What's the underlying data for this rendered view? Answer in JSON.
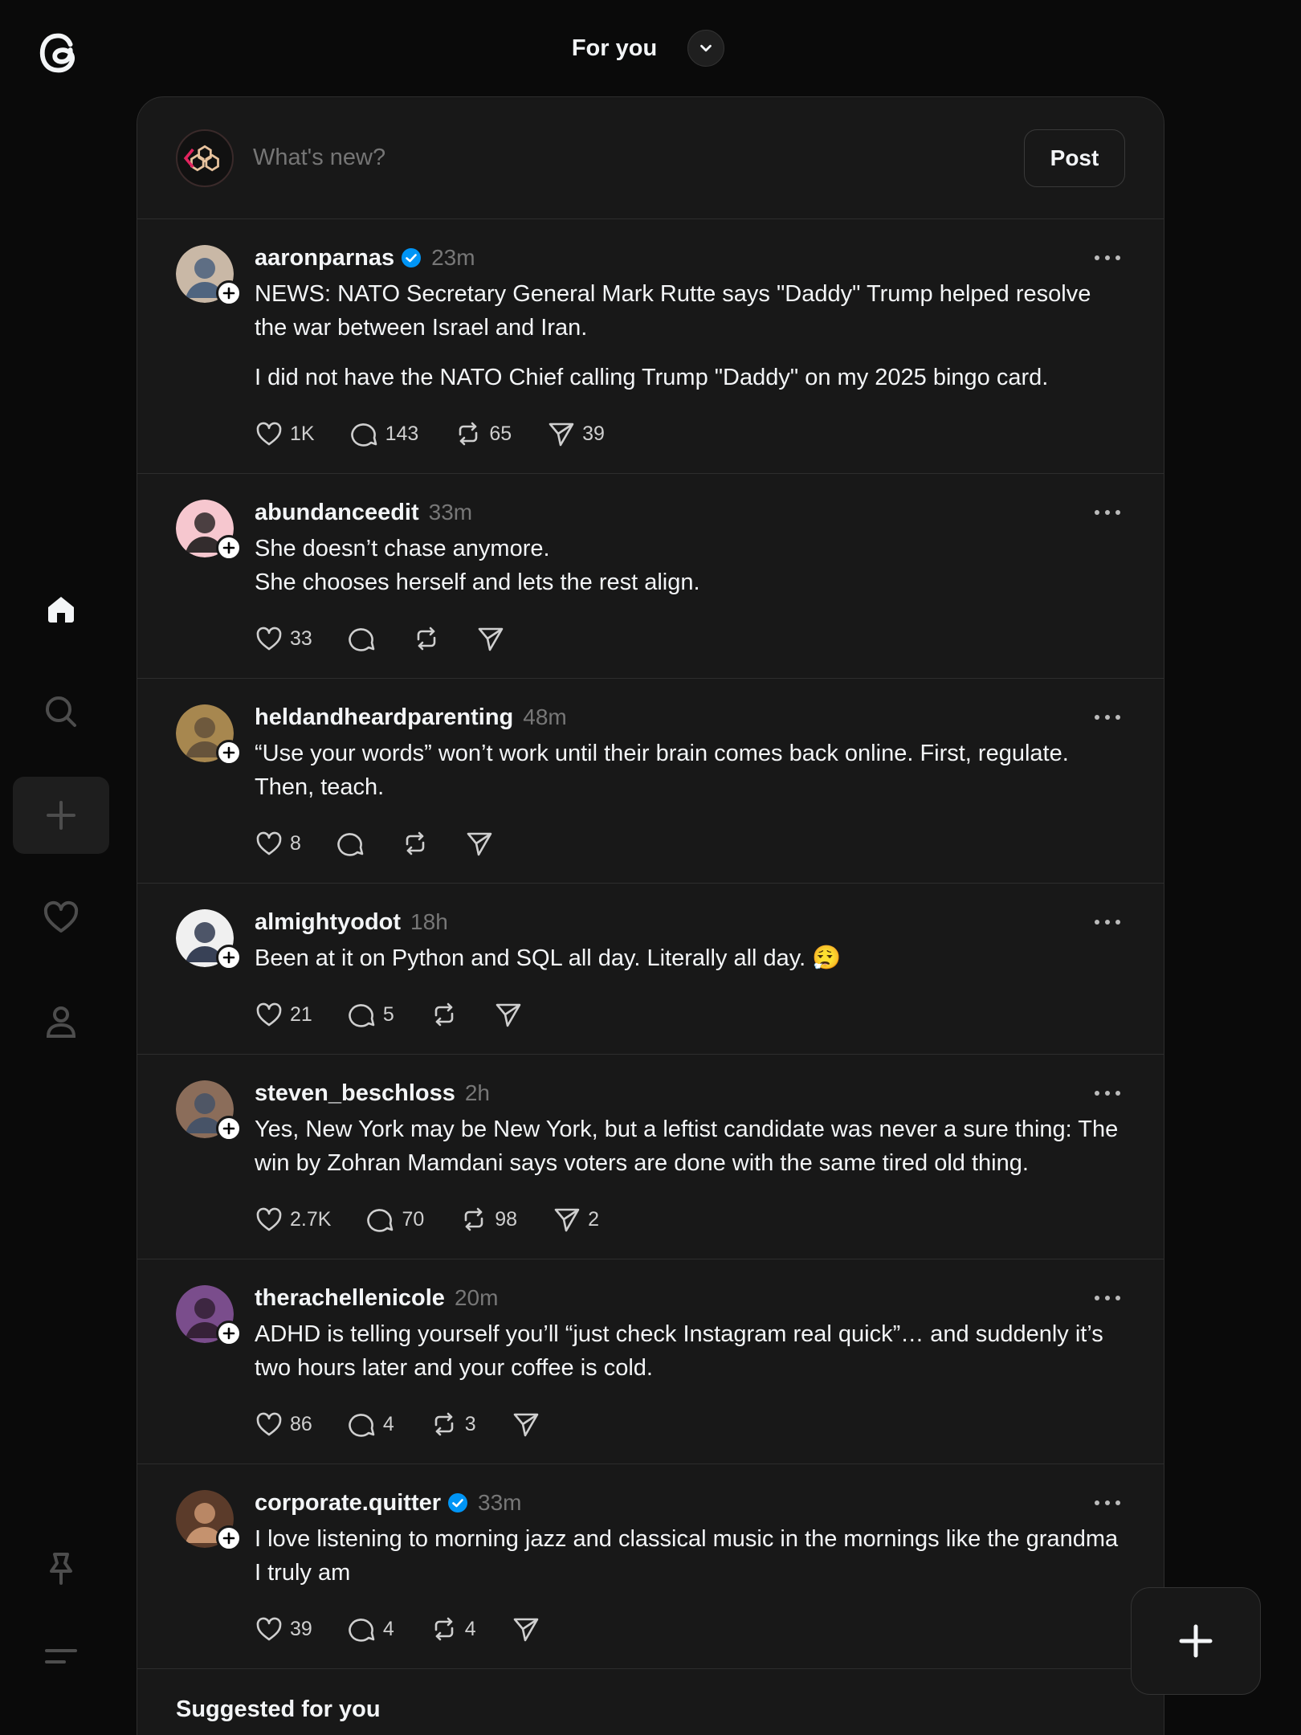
{
  "header": {
    "title": "For you"
  },
  "composer": {
    "placeholder": "What's new?",
    "post_label": "Post"
  },
  "icons": {
    "logo": "threads-logo-icon",
    "home": "home-icon",
    "search": "search-icon",
    "create": "plus-icon",
    "activity": "heart-icon",
    "profile": "profile-icon",
    "pin": "pin-icon",
    "menu": "menu-icon"
  },
  "colors": {
    "background": "#0a0a0a",
    "panel": "#181818",
    "verified": "#0095f6"
  },
  "posts": [
    {
      "username": "aaronparnas",
      "verified": true,
      "time": "23m",
      "paragraphs": [
        "NEWS: NATO Secretary General Mark Rutte says \"Daddy\" Trump helped resolve the war between Israel and Iran.",
        "I did not have the NATO Chief calling Trump \"Daddy\" on my 2025 bingo card."
      ],
      "likes": "1K",
      "replies": "143",
      "reposts": "65",
      "shares": "39"
    },
    {
      "username": "abundanceedit",
      "verified": false,
      "time": "33m",
      "paragraphs": [
        "She doesn’t chase anymore.\nShe chooses herself and lets the rest align."
      ],
      "likes": "33",
      "replies": "",
      "reposts": "",
      "shares": ""
    },
    {
      "username": "heldandheardparenting",
      "verified": false,
      "time": "48m",
      "paragraphs": [
        "“Use your words” won’t work until their brain comes back online. First, regulate. Then, teach."
      ],
      "likes": "8",
      "replies": "",
      "reposts": "",
      "shares": ""
    },
    {
      "username": "almightyodot",
      "verified": false,
      "time": "18h",
      "paragraphs": [
        "Been at it on Python and SQL all day. Literally all day. 😮‍💨"
      ],
      "likes": "21",
      "replies": "5",
      "reposts": "",
      "shares": ""
    },
    {
      "username": "steven_beschloss",
      "verified": false,
      "time": "2h",
      "paragraphs": [
        "Yes, New York may be New York, but a leftist candidate was never a sure thing: The win by Zohran Mamdani says voters are done with the same tired old thing."
      ],
      "likes": "2.7K",
      "replies": "70",
      "reposts": "98",
      "shares": "2"
    },
    {
      "username": "therachellenicole",
      "verified": false,
      "time": "20m",
      "paragraphs": [
        "ADHD is telling yourself you’ll “just check Instagram real quick”… and suddenly it’s two hours later and your coffee is cold."
      ],
      "likes": "86",
      "replies": "4",
      "reposts": "3",
      "shares": ""
    },
    {
      "username": "corporate.quitter",
      "verified": true,
      "time": "33m",
      "paragraphs": [
        "I love listening to morning jazz and classical music in the mornings like the grandma I truly am"
      ],
      "likes": "39",
      "replies": "4",
      "reposts": "4",
      "shares": ""
    }
  ],
  "suggested": {
    "title": "Suggested for you"
  }
}
